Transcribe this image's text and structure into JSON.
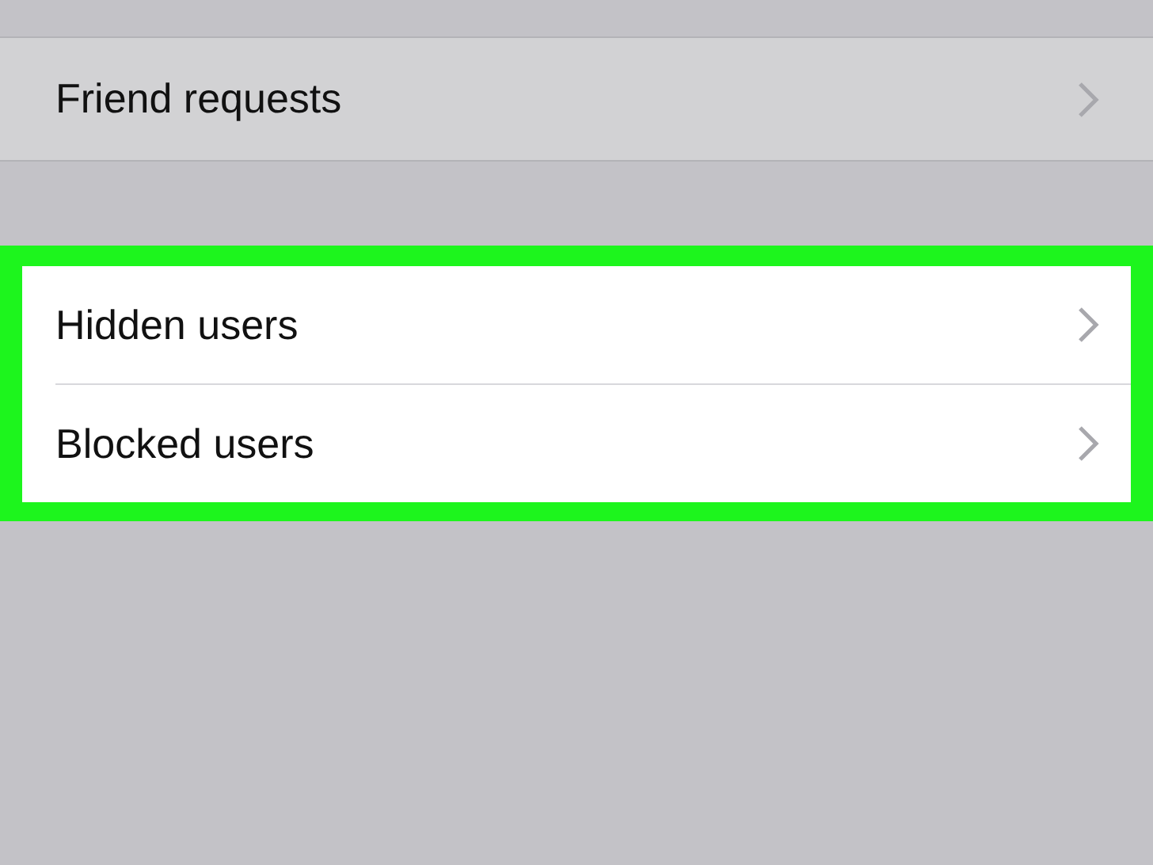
{
  "groups": [
    {
      "highlighted": false,
      "rows": [
        {
          "label": "Friend requests"
        }
      ]
    },
    {
      "highlighted": true,
      "rows": [
        {
          "label": "Hidden users"
        },
        {
          "label": "Blocked users"
        }
      ]
    }
  ]
}
